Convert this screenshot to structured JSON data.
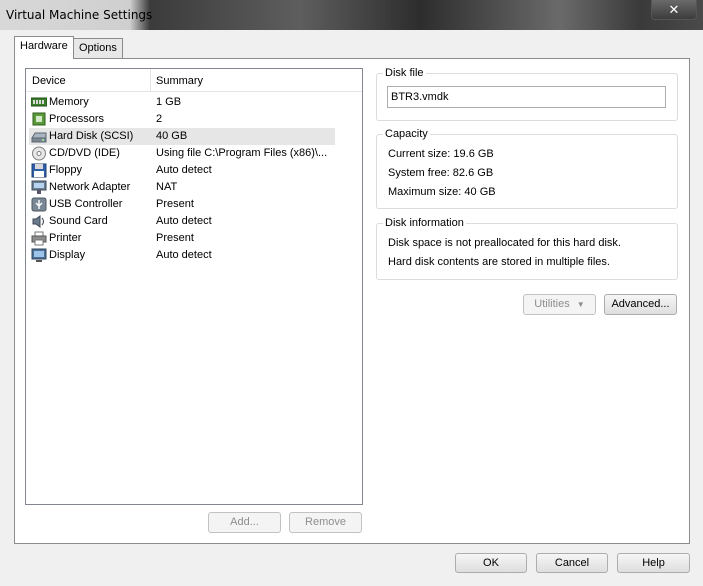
{
  "window": {
    "title": "Virtual Machine Settings",
    "close_label": "✕"
  },
  "tabs": [
    {
      "label": "Hardware",
      "active": true
    },
    {
      "label": "Options",
      "active": false
    }
  ],
  "device_list": {
    "headers": {
      "device": "Device",
      "summary": "Summary"
    },
    "rows": [
      {
        "device": "Memory",
        "summary": "1 GB",
        "icon": "memory-icon"
      },
      {
        "device": "Processors",
        "summary": "2",
        "icon": "processor-icon"
      },
      {
        "device": "Hard Disk (SCSI)",
        "summary": "40 GB",
        "icon": "hard-disk-icon",
        "selected": true
      },
      {
        "device": "CD/DVD (IDE)",
        "summary": "Using file C:\\Program Files (x86)\\...",
        "icon": "cd-dvd-icon"
      },
      {
        "device": "Floppy",
        "summary": "Auto detect",
        "icon": "floppy-icon"
      },
      {
        "device": "Network Adapter",
        "summary": "NAT",
        "icon": "network-adapter-icon"
      },
      {
        "device": "USB Controller",
        "summary": "Present",
        "icon": "usb-icon"
      },
      {
        "device": "Sound Card",
        "summary": "Auto detect",
        "icon": "sound-card-icon"
      },
      {
        "device": "Printer",
        "summary": "Present",
        "icon": "printer-icon"
      },
      {
        "device": "Display",
        "summary": "Auto detect",
        "icon": "display-icon"
      }
    ]
  },
  "list_buttons": {
    "add": "Add...",
    "remove": "Remove"
  },
  "disk_file": {
    "label": "Disk file",
    "value": "BTR3.vmdk"
  },
  "capacity": {
    "label": "Capacity",
    "current": "Current size:  19.6 GB",
    "free": "System free:  82.6 GB",
    "max": "Maximum size:  40 GB"
  },
  "disk_info": {
    "label": "Disk information",
    "line1": "Disk space is not preallocated for this hard disk.",
    "line2": "Hard disk contents are stored in multiple files."
  },
  "disk_buttons": {
    "utilities": "Utilities",
    "advanced": "Advanced..."
  },
  "dialog_buttons": {
    "ok": "OK",
    "cancel": "Cancel",
    "help": "Help"
  }
}
